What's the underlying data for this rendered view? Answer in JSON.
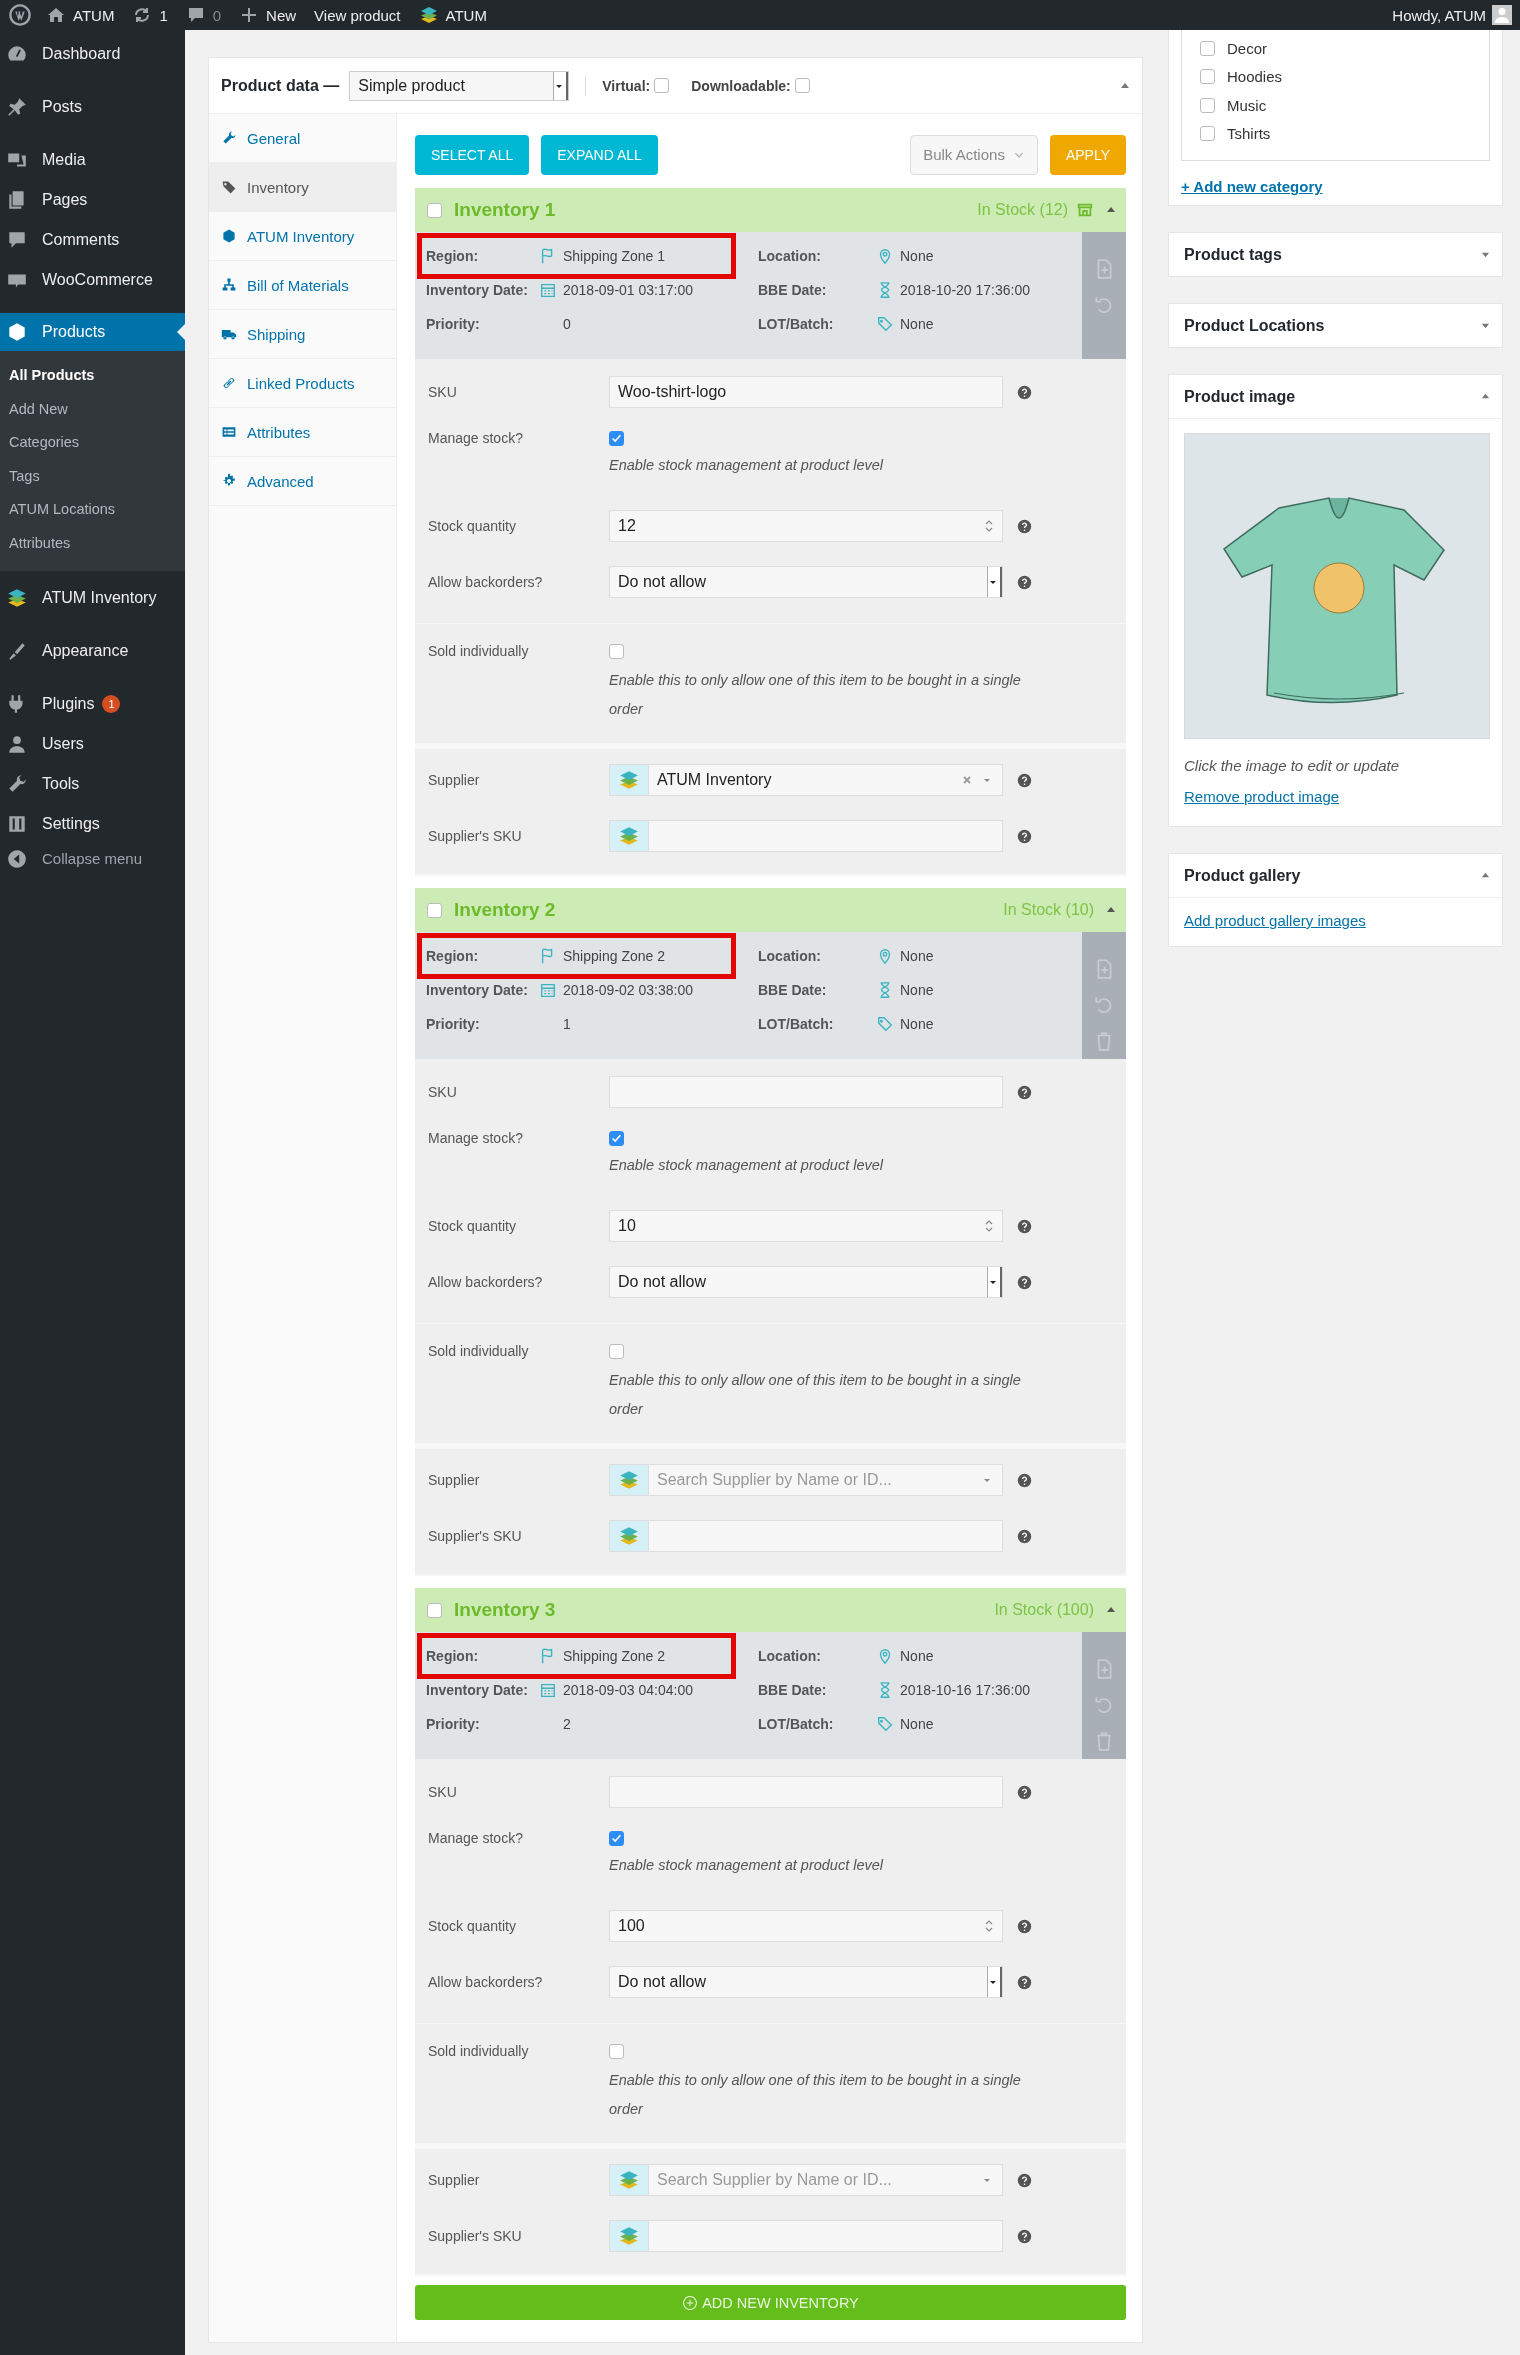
{
  "admin_bar": {
    "site": "ATUM",
    "updates": "1",
    "comments": "0",
    "new": "New",
    "view": "View product",
    "plugin": "ATUM",
    "greeting": "Howdy, ATUM"
  },
  "sidebar": {
    "items": [
      {
        "label": "Dashboard",
        "selected": false
      },
      {
        "label": "Posts",
        "selected": false
      },
      {
        "label": "Media",
        "selected": false
      },
      {
        "label": "Pages",
        "selected": false
      },
      {
        "label": "Comments",
        "selected": false
      },
      {
        "label": "WooCommerce",
        "selected": false
      },
      {
        "label": "Products",
        "selected": true,
        "children": [
          {
            "label": "All Products",
            "selected": true
          },
          {
            "label": "Add New",
            "selected": false
          },
          {
            "label": "Categories",
            "selected": false
          },
          {
            "label": "Tags",
            "selected": false
          },
          {
            "label": "ATUM Locations",
            "selected": false
          },
          {
            "label": "Attributes",
            "selected": false
          }
        ]
      },
      {
        "label": "ATUM Inventory",
        "selected": false
      },
      {
        "label": "Appearance",
        "selected": false
      },
      {
        "label": "Plugins",
        "selected": false,
        "badge": "1"
      },
      {
        "label": "Users",
        "selected": false
      },
      {
        "label": "Tools",
        "selected": false
      },
      {
        "label": "Settings",
        "selected": false
      }
    ],
    "collapse": "Collapse menu"
  },
  "product_data": {
    "title": "Product data —",
    "type": "Simple product",
    "options": [
      {
        "label": "Virtual:",
        "checked": false
      },
      {
        "label": "Downloadable:",
        "checked": false
      }
    ],
    "tabs": [
      {
        "label": "General",
        "selected": false
      },
      {
        "label": "Inventory",
        "selected": true
      },
      {
        "label": "ATUM Inventory",
        "selected": false
      },
      {
        "label": "Bill of Materials",
        "selected": false
      },
      {
        "label": "Shipping",
        "selected": false
      },
      {
        "label": "Linked Products",
        "selected": false
      },
      {
        "label": "Attributes",
        "selected": false
      },
      {
        "label": "Advanced",
        "selected": false
      }
    ],
    "toolbar": {
      "select_all": "SELECT ALL",
      "expand_all": "EXPAND ALL",
      "bulk_actions": "Bulk Actions",
      "apply": "APPLY"
    },
    "inventories": [
      {
        "title": "Inventory 1",
        "checked": false,
        "status": "In Stock (12)",
        "store_icon": true,
        "deletable": false,
        "meta": [
          {
            "label": "Region:",
            "value": "Shipping Zone 1",
            "highlighted": true
          },
          {
            "label": "Location:",
            "value": "None",
            "highlighted": false
          },
          {
            "label": "Inventory Date:",
            "value": "2018-09-01 03:17:00",
            "highlighted": false
          },
          {
            "label": "BBE Date:",
            "value": "2018-10-20 17:36:00",
            "highlighted": false
          },
          {
            "label": "Priority:",
            "value": "0",
            "highlighted": false
          },
          {
            "label": "LOT/Batch:",
            "value": "None",
            "highlighted": false
          }
        ],
        "sku": {
          "label": "SKU",
          "value": "Woo-tshirt-logo"
        },
        "manage_stock": {
          "label": "Manage stock?",
          "checked": true,
          "description": "Enable stock management at product level"
        },
        "stock_quantity": {
          "label": "Stock quantity",
          "value": "12"
        },
        "backorders": {
          "label": "Allow backorders?",
          "value": "Do not allow"
        },
        "sold_individually": {
          "label": "Sold individually",
          "checked": false,
          "description": "Enable this to only allow one of this item to be bought in a single order"
        },
        "supplier": {
          "label": "Supplier",
          "value": "ATUM Inventory"
        },
        "supplier_sku": {
          "label": "Supplier's SKU"
        }
      },
      {
        "title": "Inventory 2",
        "checked": false,
        "status": "In Stock (10)",
        "store_icon": false,
        "deletable": true,
        "meta": [
          {
            "label": "Region:",
            "value": "Shipping Zone 2",
            "highlighted": true
          },
          {
            "label": "Location:",
            "value": "None",
            "highlighted": false
          },
          {
            "label": "Inventory Date:",
            "value": "2018-09-02 03:38:00",
            "highlighted": false
          },
          {
            "label": "BBE Date:",
            "value": "None",
            "highlighted": false
          },
          {
            "label": "Priority:",
            "value": "1",
            "highlighted": false
          },
          {
            "label": "LOT/Batch:",
            "value": "None",
            "highlighted": false
          }
        ],
        "sku": {
          "label": "SKU"
        },
        "manage_stock": {
          "label": "Manage stock?",
          "checked": true,
          "description": "Enable stock management at product level"
        },
        "stock_quantity": {
          "label": "Stock quantity",
          "value": "10"
        },
        "backorders": {
          "label": "Allow backorders?",
          "value": "Do not allow"
        },
        "sold_individually": {
          "label": "Sold individually",
          "checked": false,
          "description": "Enable this to only allow one of this item to be bought in a single order"
        },
        "supplier": {
          "label": "Supplier",
          "placeholder": "Search Supplier by Name or ID..."
        },
        "supplier_sku": {
          "label": "Supplier's SKU"
        }
      },
      {
        "title": "Inventory 3",
        "checked": false,
        "status": "In Stock (100)",
        "store_icon": false,
        "deletable": true,
        "meta": [
          {
            "label": "Region:",
            "value": "Shipping Zone 2",
            "highlighted": true
          },
          {
            "label": "Location:",
            "value": "None",
            "highlighted": false
          },
          {
            "label": "Inventory Date:",
            "value": "2018-09-03 04:04:00",
            "highlighted": false
          },
          {
            "label": "BBE Date:",
            "value": "2018-10-16 17:36:00",
            "highlighted": false
          },
          {
            "label": "Priority:",
            "value": "2",
            "highlighted": false
          },
          {
            "label": "LOT/Batch:",
            "value": "None",
            "highlighted": false
          }
        ],
        "sku": {
          "label": "SKU"
        },
        "manage_stock": {
          "label": "Manage stock?",
          "checked": true,
          "description": "Enable stock management at product level"
        },
        "stock_quantity": {
          "label": "Stock quantity",
          "value": "100"
        },
        "backorders": {
          "label": "Allow backorders?",
          "value": "Do not allow"
        },
        "sold_individually": {
          "label": "Sold individually",
          "checked": false,
          "description": "Enable this to only allow one of this item to be bought in a single order"
        },
        "supplier": {
          "label": "Supplier",
          "placeholder": "Search Supplier by Name or ID..."
        },
        "supplier_sku": {
          "label": "Supplier's SKU"
        }
      }
    ],
    "add_button": "ADD NEW INVENTORY"
  },
  "side": {
    "categories": [
      {
        "label": "Decor",
        "checked": false
      },
      {
        "label": "Hoodies",
        "checked": false
      },
      {
        "label": "Music",
        "checked": false
      },
      {
        "label": "Tshirts",
        "checked": false
      }
    ],
    "add_category": "+ Add new category",
    "boxes": [
      {
        "title": "Product tags",
        "expanded": false
      },
      {
        "title": "Product Locations",
        "expanded": false
      }
    ],
    "product_image": {
      "title": "Product image",
      "expanded": true,
      "caption": "Click the image to edit or update",
      "remove": "Remove product image"
    },
    "gallery": {
      "title": "Product gallery",
      "expanded": true,
      "link": "Add product gallery images"
    }
  }
}
